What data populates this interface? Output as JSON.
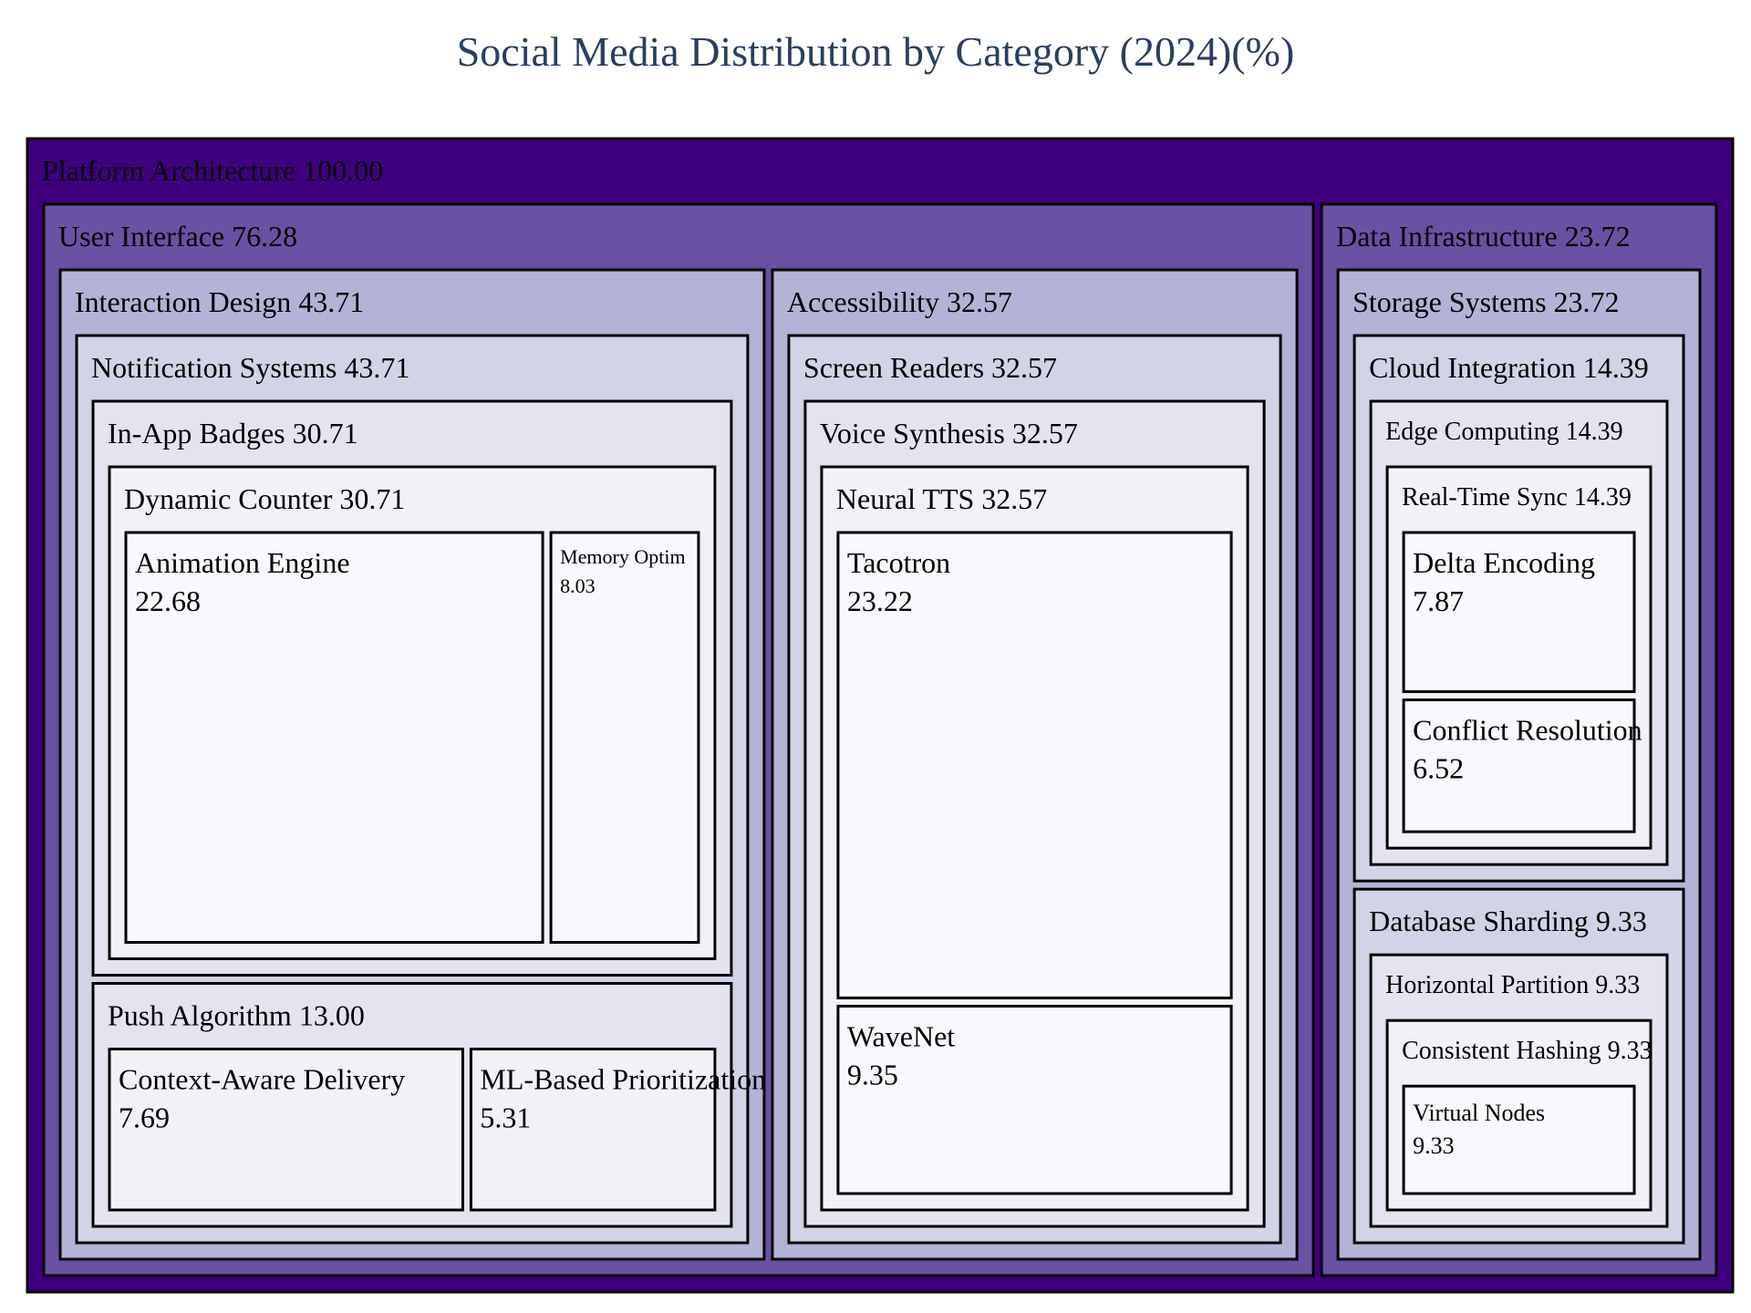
{
  "chart_data": {
    "type": "treemap",
    "title": "Social Media Distribution by Category (2024)(%)",
    "colors": {
      "border": "#000000",
      "depth": [
        "#3f007d",
        "#6a51a3",
        "#b3b3d7",
        "#d3d3e7",
        "#e4e4f0",
        "#f2f1f7",
        "#f9f8fc"
      ]
    },
    "root": {
      "name": "Platform Architecture",
      "value": 100.0,
      "children": [
        {
          "name": "User Interface",
          "value": 76.28,
          "children": [
            {
              "name": "Interaction Design",
              "value": 43.71,
              "children": [
                {
                  "name": "Notification Systems",
                  "value": 43.71,
                  "children": [
                    {
                      "name": "In-App Badges",
                      "value": 30.71,
                      "children": [
                        {
                          "name": "Dynamic Counter",
                          "value": 30.71,
                          "children": [
                            {
                              "name": "Animation Engine",
                              "value": 22.68
                            },
                            {
                              "name": "Memory Optim",
                              "value": 8.03
                            }
                          ]
                        }
                      ]
                    },
                    {
                      "name": "Push Algorithm",
                      "value": 13.0,
                      "children": [
                        {
                          "name": "Context-Aware Delivery",
                          "value": 7.69
                        },
                        {
                          "name": "ML-Based Prioritization",
                          "value": 5.31
                        }
                      ]
                    }
                  ]
                }
              ]
            },
            {
              "name": "Accessibility",
              "value": 32.57,
              "children": [
                {
                  "name": "Screen Readers",
                  "value": 32.57,
                  "children": [
                    {
                      "name": "Voice Synthesis",
                      "value": 32.57,
                      "children": [
                        {
                          "name": "Neural TTS",
                          "value": 32.57,
                          "children": [
                            {
                              "name": "Tacotron",
                              "value": 23.22
                            },
                            {
                              "name": "WaveNet",
                              "value": 9.35
                            }
                          ]
                        }
                      ]
                    }
                  ]
                }
              ]
            }
          ]
        },
        {
          "name": "Data Infrastructure",
          "value": 23.72,
          "children": [
            {
              "name": "Storage Systems",
              "value": 23.72,
              "children": [
                {
                  "name": "Cloud Integration",
                  "value": 14.39,
                  "children": [
                    {
                      "name": "Edge Computing",
                      "value": 14.39,
                      "children": [
                        {
                          "name": "Real-Time Sync",
                          "value": 14.39,
                          "children": [
                            {
                              "name": "Delta Encoding",
                              "value": 7.87
                            },
                            {
                              "name": "Conflict Resolution",
                              "value": 6.52
                            }
                          ]
                        }
                      ]
                    }
                  ]
                },
                {
                  "name": "Database Sharding",
                  "value": 9.33,
                  "children": [
                    {
                      "name": "Horizontal Partition",
                      "value": 9.33,
                      "children": [
                        {
                          "name": "Consistent Hashing",
                          "value": 9.33,
                          "children": [
                            {
                              "name": "Virtual Nodes",
                              "value": 9.33
                            }
                          ]
                        }
                      ]
                    }
                  ]
                }
              ]
            }
          ]
        }
      ]
    }
  }
}
